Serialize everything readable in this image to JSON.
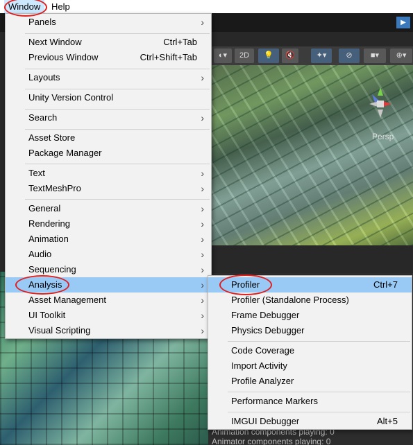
{
  "menubar": {
    "items": [
      {
        "label": "Window",
        "active": true
      },
      {
        "label": "Help",
        "active": false
      }
    ]
  },
  "editor": {
    "play_icon": "play-icon",
    "scene_toolbar": {
      "mode_2d": "2D",
      "icons": [
        "circle-dropdown-icon",
        "light-bulb-icon",
        "audio-mute-icon",
        "effects-icon",
        "hidden-objects-icon",
        "camera-icon",
        "gizmos-icon"
      ]
    },
    "view_label": "Persp",
    "stats": [
      "Animation components playing: 0",
      "Animator components playing: 0"
    ]
  },
  "window_menu": {
    "groups": [
      [
        {
          "label": "Panels",
          "submenu": true
        }
      ],
      [
        {
          "label": "Next Window",
          "shortcut": "Ctrl+Tab"
        },
        {
          "label": "Previous Window",
          "shortcut": "Ctrl+Shift+Tab"
        }
      ],
      [
        {
          "label": "Layouts",
          "submenu": true
        }
      ],
      [
        {
          "label": "Unity Version Control"
        }
      ],
      [
        {
          "label": "Search",
          "submenu": true
        }
      ],
      [
        {
          "label": "Asset Store"
        },
        {
          "label": "Package Manager"
        }
      ],
      [
        {
          "label": "Text",
          "submenu": true
        },
        {
          "label": "TextMeshPro",
          "submenu": true
        }
      ],
      [
        {
          "label": "General",
          "submenu": true
        },
        {
          "label": "Rendering",
          "submenu": true
        },
        {
          "label": "Animation",
          "submenu": true
        },
        {
          "label": "Audio",
          "submenu": true
        },
        {
          "label": "Sequencing",
          "submenu": true
        },
        {
          "label": "Analysis",
          "submenu": true,
          "highlighted": true
        },
        {
          "label": "Asset Management",
          "submenu": true
        },
        {
          "label": "UI Toolkit",
          "submenu": true
        },
        {
          "label": "Visual Scripting",
          "submenu": true
        }
      ]
    ]
  },
  "analysis_submenu": {
    "groups": [
      [
        {
          "label": "Profiler",
          "shortcut": "Ctrl+7"
        },
        {
          "label": "Profiler (Standalone Process)"
        },
        {
          "label": "Frame Debugger"
        },
        {
          "label": "Physics Debugger"
        }
      ],
      [
        {
          "label": "Code Coverage"
        },
        {
          "label": "Import Activity"
        },
        {
          "label": "Profile Analyzer"
        }
      ],
      [
        {
          "label": "Performance Markers"
        }
      ],
      [
        {
          "label": "IMGUI Debugger",
          "shortcut": "Alt+5"
        }
      ]
    ]
  },
  "colors": {
    "menu_bg": "#f2f2f2",
    "highlight": "#99c9f5",
    "annotation_circle": "#e02020",
    "menubar_active": "#cce8ff"
  }
}
